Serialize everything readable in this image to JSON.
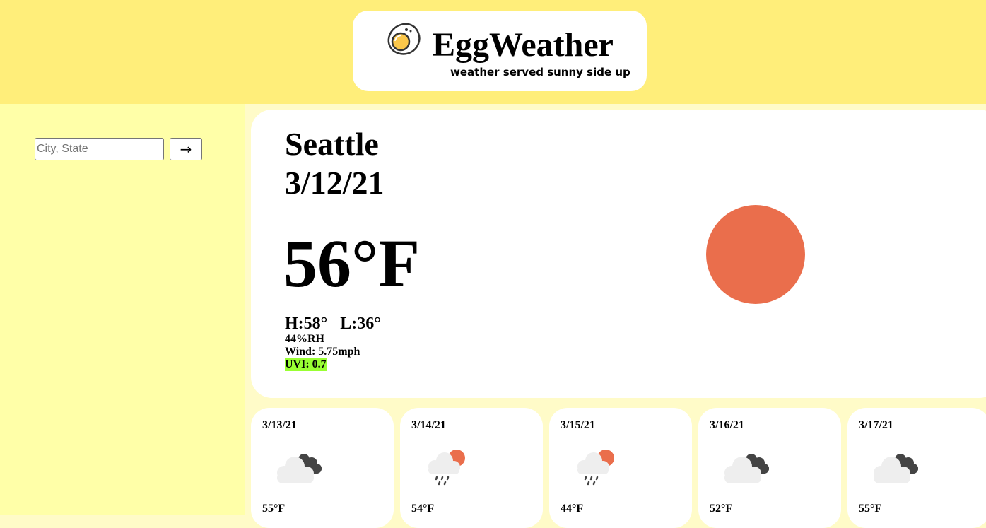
{
  "app": {
    "title": "EggWeather",
    "tagline": "weather served sunny side up"
  },
  "search": {
    "placeholder": "City, State",
    "value": "",
    "button_label": "→"
  },
  "current": {
    "city": "Seattle",
    "date": "3/12/21",
    "temperature": "56°F",
    "hilo": "H:58°   L:36°",
    "humidity": "44%RH",
    "wind": "Wind: 5.75mph",
    "uvi": "UVI: 0.7",
    "icon": "sun-icon"
  },
  "forecast": [
    {
      "date": "3/13/21",
      "temp": "55°F",
      "icon": "cloudy-icon"
    },
    {
      "date": "3/14/21",
      "temp": "54°F",
      "icon": "rain-sun-icon"
    },
    {
      "date": "3/15/21",
      "temp": "44°F",
      "icon": "rain-sun-icon"
    },
    {
      "date": "3/16/21",
      "temp": "52°F",
      "icon": "cloudy-icon"
    },
    {
      "date": "3/17/21",
      "temp": "55°F",
      "icon": "cloudy-icon"
    }
  ],
  "colors": {
    "header_bg": "#ffee7a",
    "sidebar_bg": "#ffffa8",
    "page_bg": "#fffbc8",
    "sun": "#ea6e4c",
    "uvi_highlight": "#99ff33"
  }
}
